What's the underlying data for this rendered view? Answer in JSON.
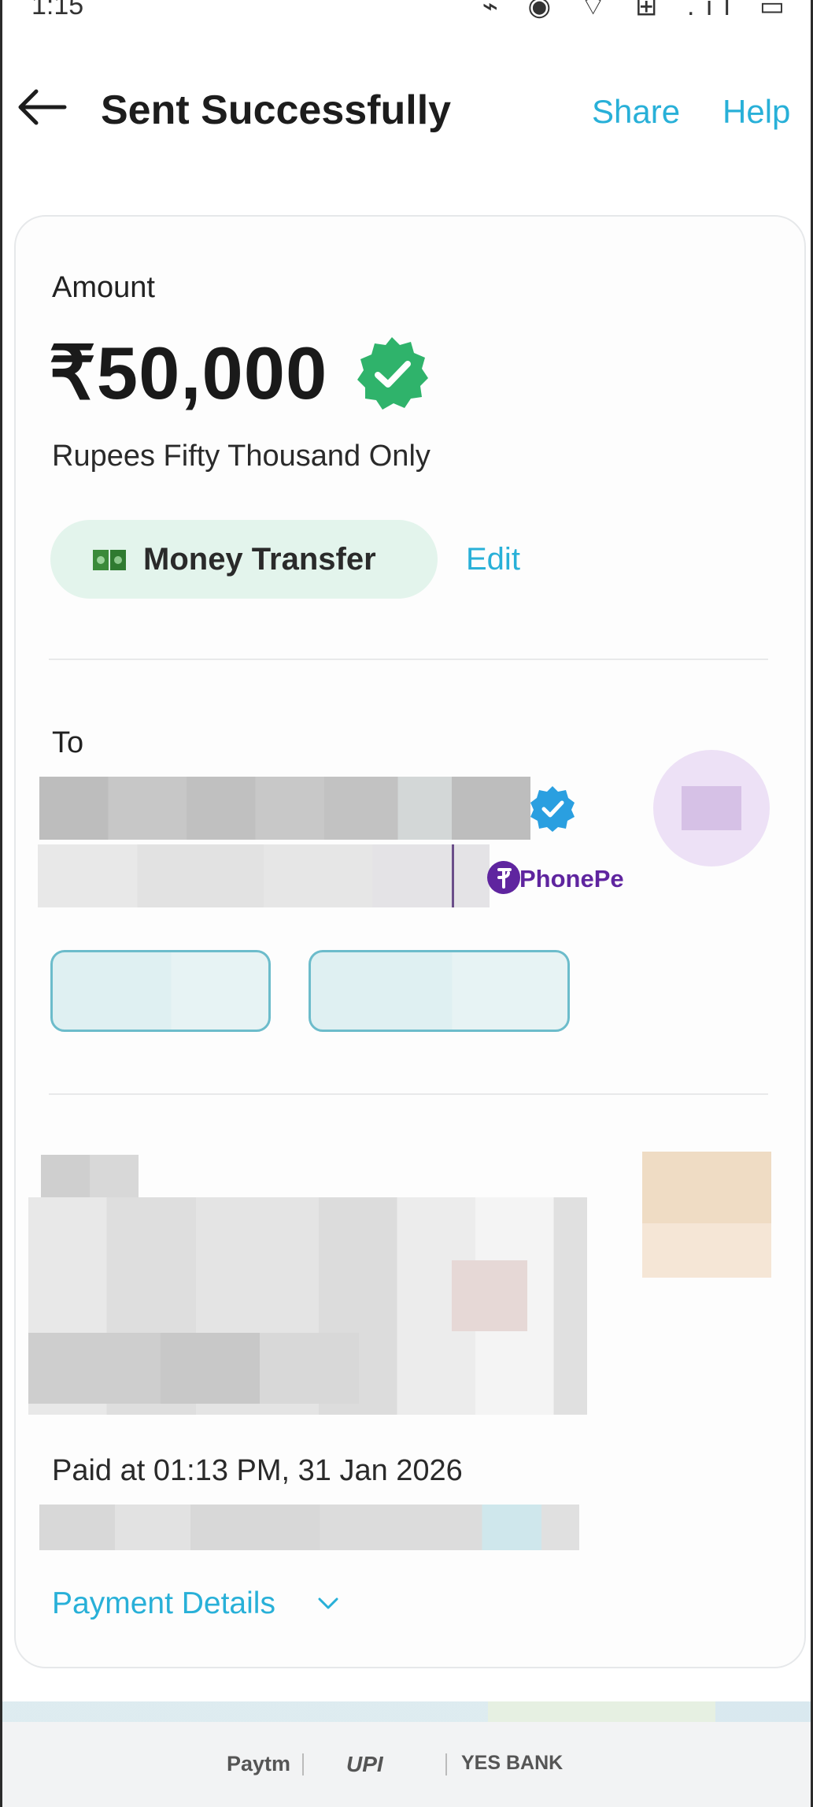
{
  "status_bar": {
    "time": "1:15",
    "icons": "⌁ ◉ ⌔ ⊞ .ıl ▭"
  },
  "header": {
    "back_icon": "arrow-left-icon",
    "title": "Sent Successfully",
    "share_label": "Share",
    "help_label": "Help"
  },
  "payment": {
    "amount_label": "Amount",
    "amount": "₹50,000",
    "amount_in_words": "Rupees Fifty Thousand Only",
    "category": "Money Transfer",
    "edit_label": "Edit",
    "status_icon": "verified-check-icon"
  },
  "recipient": {
    "to_label": "To",
    "app_label": "PhonePe"
  },
  "transaction": {
    "paid_at": "Paid at 01:13 PM, 31 Jan 2026",
    "details_label": "Payment Details"
  },
  "footer": {
    "paytm": "Paytm",
    "upi": "UPI",
    "bank": "YES BANK"
  },
  "colors": {
    "accent": "#28b0d8",
    "success": "#2fb36b",
    "chip_bg": "#e3f4ec",
    "phonepe": "#5f259f"
  }
}
